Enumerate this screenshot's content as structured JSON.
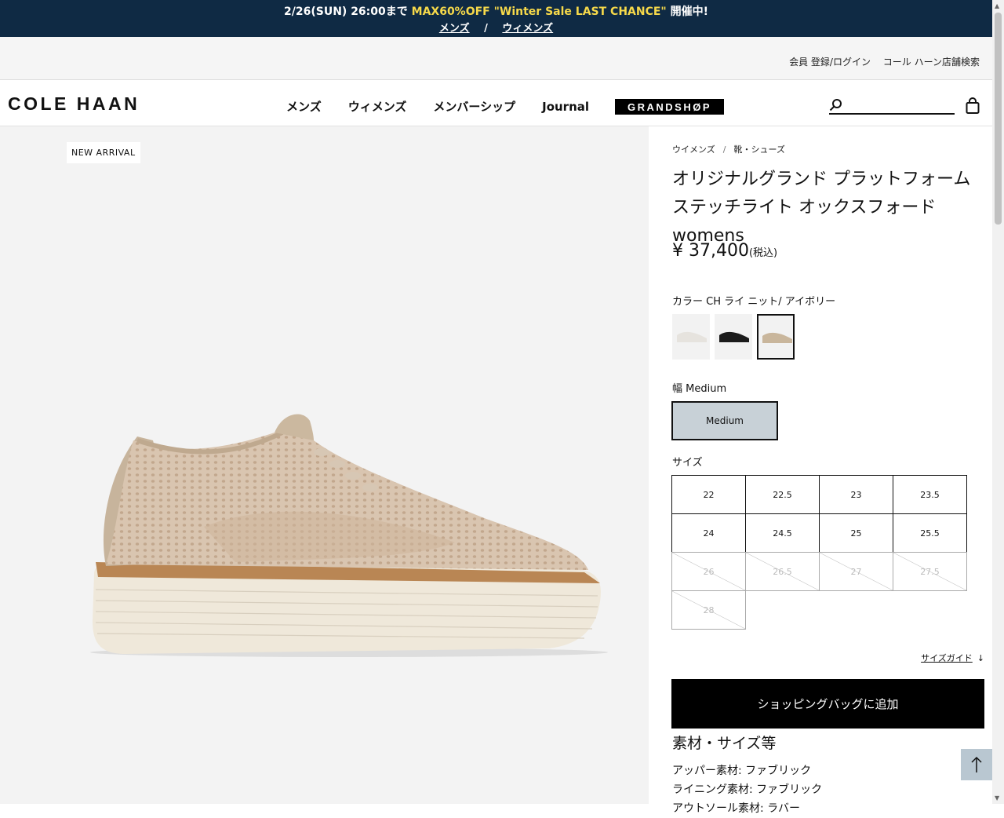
{
  "promo": {
    "prefix": "2/26(SUN) 26:00まで ",
    "highlight": "MAX60%OFF \"Winter Sale LAST CHANCE\"",
    "suffix": " 開催中!",
    "link_mens": "メンズ",
    "separator": "/",
    "link_womens": "ウィメンズ"
  },
  "util": {
    "login": "会員 登録/ログイン",
    "store_search": "コール ハーン店舗検索"
  },
  "header": {
    "logo": "COLE HAAN",
    "nav": [
      "メンズ",
      "ウィメンズ",
      "メンバーシップ",
      "Journal"
    ],
    "grandshop": "GRANDSHØP",
    "search_placeholder": ""
  },
  "gallery": {
    "badge": "NEW ARRIVAL"
  },
  "product": {
    "breadcrumb": [
      "ウイメンズ",
      "靴・シューズ"
    ],
    "breadcrumb_sep": "/",
    "title": "オリジナルグランド プラットフォーム ステッチライト オックスフォード womens",
    "price": "¥ 37,400",
    "tax": "(税込)",
    "color_label": "カラー CH ライ ニット/ アイボリー",
    "swatch_colors": [
      "#e6e3de",
      "#1b1b1b",
      "#c9b69c"
    ],
    "width_label": "幅 Medium",
    "width_option": "Medium",
    "size_label": "サイズ",
    "sizes": [
      {
        "label": "22",
        "available": true
      },
      {
        "label": "22.5",
        "available": true
      },
      {
        "label": "23",
        "available": true
      },
      {
        "label": "23.5",
        "available": true
      },
      {
        "label": "24",
        "available": true
      },
      {
        "label": "24.5",
        "available": true
      },
      {
        "label": "25",
        "available": true
      },
      {
        "label": "25.5",
        "available": true
      },
      {
        "label": "26",
        "available": false
      },
      {
        "label": "26.5",
        "available": false
      },
      {
        "label": "27",
        "available": false
      },
      {
        "label": "27.5",
        "available": false
      },
      {
        "label": "28",
        "available": false
      }
    ],
    "size_guide": "サイズガイド",
    "add_to_bag": "ショッピングバッグに追加",
    "spec_heading": "素材・サイズ等",
    "spec_lines": [
      "アッパー素材: ファブリック",
      "ライニング素材: ファブリック",
      "アウトソール素材: ラバー"
    ]
  }
}
